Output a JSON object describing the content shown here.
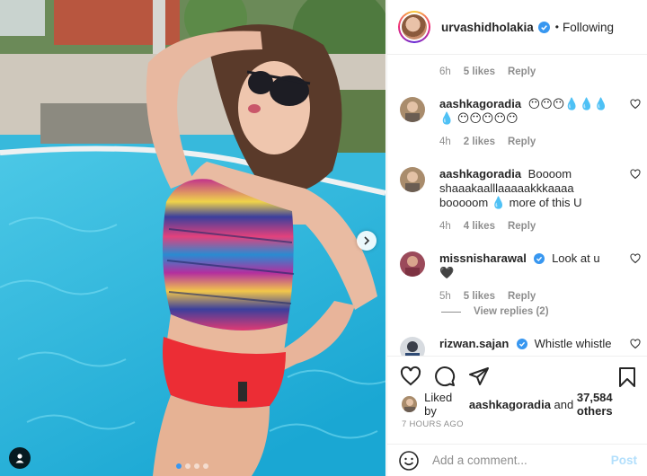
{
  "header": {
    "username": "urvashidholakia",
    "separator": "•",
    "follow_state": "Following"
  },
  "top_meta": {
    "time": "6h",
    "likes": "5 likes",
    "reply": "Reply"
  },
  "comments": [
    {
      "user": "aashkagoradia",
      "text": "😶😶😶💧💧💧💧 😶😶😶😶😶",
      "time": "4h",
      "likes": "2 likes",
      "reply": "Reply",
      "verified": false
    },
    {
      "user": "aashkagoradia",
      "text": "Boooom shaaakaalllaaaaakkkaaaa booooom 💧 more of this U",
      "time": "4h",
      "likes": "4 likes",
      "reply": "Reply",
      "verified": false
    },
    {
      "user": "missnisharawal",
      "text": "Look at u 🖤",
      "time": "5h",
      "likes": "5 likes",
      "reply": "Reply",
      "verified": true
    },
    {
      "user": "rizwan.sajan",
      "text": "Whistle whistle",
      "verified": true
    }
  ],
  "view_replies": "View replies (2)",
  "likes_line": {
    "prefix": "Liked by",
    "user": "aashkagoradia",
    "conj": "and",
    "count": "37,584 others"
  },
  "time_ago": "7 HOURS AGO",
  "add_comment": {
    "placeholder": "Add a comment...",
    "post": "Post"
  },
  "colors": {
    "accent": "#3897f0",
    "verified": "#3897f0",
    "post_disabled": "#b2dffc",
    "muted": "#8e8e8e"
  },
  "icons": [
    "heart-icon",
    "comment-icon",
    "share-icon",
    "bookmark-icon",
    "emoji-icon",
    "chevron-right-icon",
    "user-tag-icon",
    "verified-icon"
  ],
  "carousel": {
    "slides": 4,
    "active": 1
  }
}
